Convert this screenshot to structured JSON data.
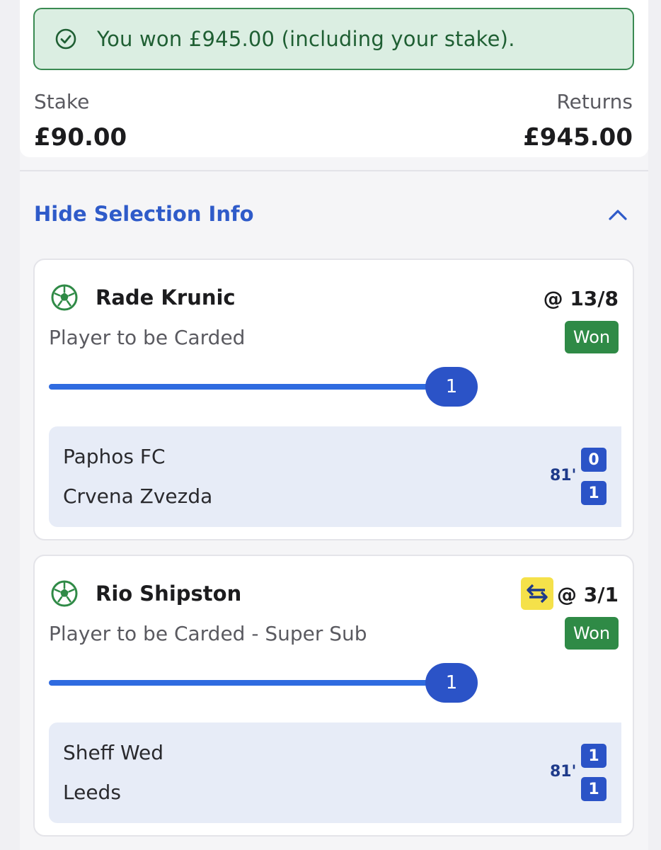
{
  "banner": {
    "message": "You won £945.00 (including your stake).",
    "icon": "check-circle-icon"
  },
  "summary": {
    "stake_label": "Stake",
    "stake_value": "£90.00",
    "returns_label": "Returns",
    "returns_value": "£945.00"
  },
  "toggle": {
    "label": "Hide Selection Info"
  },
  "selections": [
    {
      "name": "Rade Krunic",
      "odds": "@ 13/8",
      "market": "Player to be Carded",
      "status": "Won",
      "progress_value": "1",
      "teams": [
        "Paphos FC",
        "Crvena Zvezda"
      ],
      "minute": "81'",
      "scores": [
        "0",
        "1"
      ]
    },
    {
      "name": "Rio Shipston",
      "odds": "@ 3/1",
      "market": "Player to be Carded - Super Sub",
      "status": "Won",
      "progress_value": "1",
      "teams": [
        "Sheff Wed",
        "Leeds"
      ],
      "minute": "81'",
      "scores": [
        "1",
        "1"
      ]
    }
  ],
  "colors": {
    "win_green": "#2f8a46",
    "accent_blue": "#2b53c7",
    "link_blue": "#2f5bc9"
  }
}
